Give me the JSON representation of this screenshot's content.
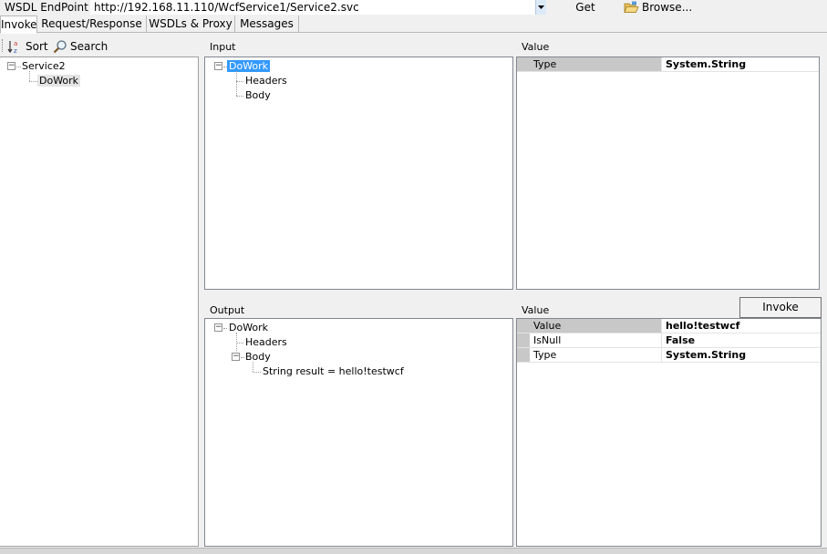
{
  "endpoint": {
    "label": "WSDL EndPoint",
    "url": "http://192.168.11.110/WcfService1/Service2.svc",
    "get_label": "Get",
    "browse_label": "Browse..."
  },
  "tabs": [
    {
      "label": "Invoke",
      "active": true
    },
    {
      "label": "Request/Response",
      "active": false
    },
    {
      "label": "WSDLs & Proxy",
      "active": false
    },
    {
      "label": "Messages",
      "active": false
    }
  ],
  "toolbar": {
    "sort_label": "Sort",
    "search_label": "Search"
  },
  "service_tree": {
    "service": "Service2",
    "operation": "DoWork"
  },
  "input": {
    "label": "Input",
    "root": "DoWork",
    "children": [
      "Headers",
      "Body"
    ]
  },
  "input_value": {
    "label": "Value",
    "rows": [
      {
        "key": "Type",
        "value": "System.String"
      }
    ]
  },
  "output": {
    "label": "Output",
    "root": "DoWork",
    "headers": "Headers",
    "body": "Body",
    "result": "String result = hello!testwcf"
  },
  "output_value": {
    "label": "Value",
    "rows": [
      {
        "key": "Value",
        "value": "hello!testwcf"
      },
      {
        "key": "IsNull",
        "value": "False"
      },
      {
        "key": "Type",
        "value": "System.String"
      }
    ]
  },
  "invoke_label": "Invoke",
  "icons": [
    "dropdown-arrow-icon",
    "folder-open-icon",
    "sort-az-icon",
    "magnifier-icon"
  ]
}
